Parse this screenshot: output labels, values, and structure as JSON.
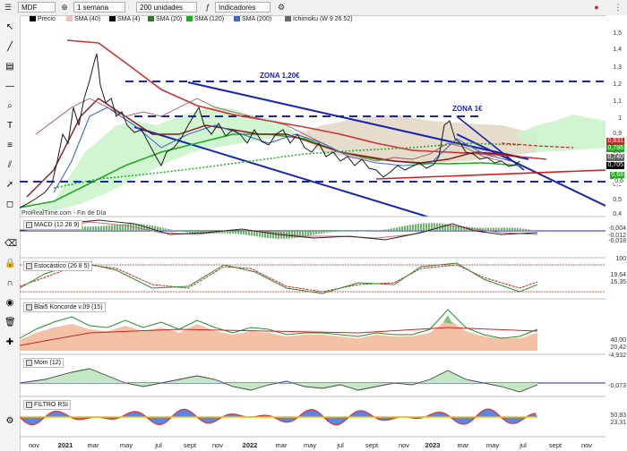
{
  "topbar": {
    "symbol": "MDF",
    "timeframe": "1 semana",
    "units": "200 unidades",
    "indicators": "Indicadores"
  },
  "legend": [
    {
      "label": "Precio",
      "color": "#000000"
    },
    {
      "label": "SMA (40)",
      "color": "#e8c4c4"
    },
    {
      "label": "SMA (4)",
      "color": "#000000"
    },
    {
      "label": "SMA (20)",
      "color": "#2f7a1f"
    },
    {
      "label": "SMA (120)",
      "color": "#22aa22"
    },
    {
      "label": "SMA (200)",
      "color": "#4466cc"
    },
    {
      "label": "Ichimoku (W 9 26 52)",
      "color": "#666666"
    }
  ],
  "annotations": {
    "zona_high": "ZONA 1,20€",
    "zona_low": "ZONA 1€"
  },
  "watermark": "ProRealTime.com - Fin de Día",
  "panels": [
    {
      "key": "macd",
      "label": "MACD (12 26 9)",
      "values": [
        "-0,004",
        "-0,012",
        "-0,018"
      ]
    },
    {
      "key": "stoch",
      "label": "Estocástico (26 8 5)",
      "values": [
        "100",
        "19,64",
        "16,35"
      ]
    },
    {
      "key": "koncorde",
      "label": "Blai5 Koncorde v.09 (15)",
      "values": [
        "40,00",
        "20,42",
        "-4,932"
      ]
    },
    {
      "key": "mom",
      "label": "Mom (12)",
      "values": [
        "-0,073"
      ]
    },
    {
      "key": "rsi",
      "label": "FILTRO RSI",
      "values": [
        "50,83",
        "23,31"
      ]
    }
  ],
  "yaxis": [
    "1,5",
    "1,4",
    "1,3",
    "1,2",
    "1,1",
    "1",
    "0,9",
    "0,8",
    "0,7",
    "0,6",
    "0,5",
    "0,4"
  ],
  "price_tags": [
    {
      "value": "0,831",
      "color": "#cc2222"
    },
    {
      "value": "0,786",
      "color": "#22aa22"
    },
    {
      "value": "0,740",
      "color": "#666666"
    },
    {
      "value": "0,705",
      "color": "#000000"
    },
    {
      "value": "0,68",
      "color": "#22aa22"
    },
    {
      "value": "0,6",
      "color": "#ffffff"
    }
  ],
  "xaxis": [
    {
      "t": "nov",
      "b": false
    },
    {
      "t": "2021",
      "b": true
    },
    {
      "t": "mar",
      "b": false
    },
    {
      "t": "may",
      "b": false
    },
    {
      "t": "jul",
      "b": false
    },
    {
      "t": "sept",
      "b": false
    },
    {
      "t": "nov",
      "b": false
    },
    {
      "t": "2022",
      "b": true
    },
    {
      "t": "mar",
      "b": false
    },
    {
      "t": "may",
      "b": false
    },
    {
      "t": "jul",
      "b": false
    },
    {
      "t": "sept",
      "b": false
    },
    {
      "t": "nov",
      "b": false
    },
    {
      "t": "2023",
      "b": true
    },
    {
      "t": "mar",
      "b": false
    },
    {
      "t": "may",
      "b": false
    },
    {
      "t": "jul",
      "b": false
    },
    {
      "t": "sept",
      "b": false
    },
    {
      "t": "nov",
      "b": false
    }
  ],
  "colors": {
    "trendline": "#1a25b0",
    "support": "#cc2222",
    "sma120": "#22aa22",
    "kumo_green": "#c9f3c9",
    "kumo_brown": "#e2d6c3"
  }
}
